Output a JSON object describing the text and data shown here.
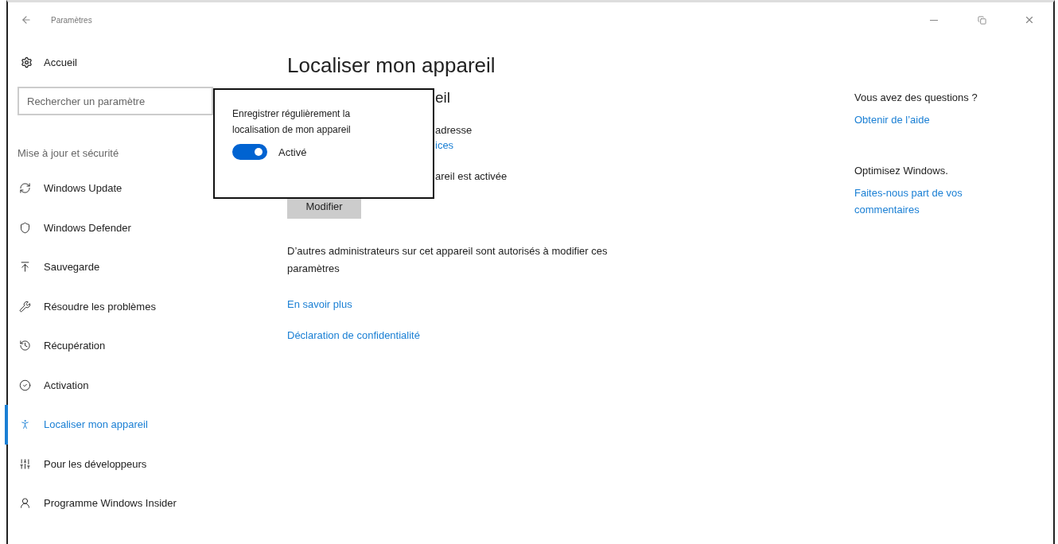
{
  "window": {
    "title": "Paramètres"
  },
  "sidebar": {
    "home": "Accueil",
    "search": {
      "placeholder": "Rechercher un paramètre"
    },
    "section": "Mise à jour et sécurité",
    "items": [
      {
        "label": "Windows Update",
        "selected": false
      },
      {
        "label": "Windows Defender",
        "selected": false
      },
      {
        "label": "Sauvegarde",
        "selected": false
      },
      {
        "label": "Résoudre les problèmes",
        "selected": false
      },
      {
        "label": "Récupération",
        "selected": false
      },
      {
        "label": "Activation",
        "selected": false
      },
      {
        "label": "Localiser mon appareil",
        "selected": true
      },
      {
        "label": "Pour les développeurs",
        "selected": false
      },
      {
        "label": "Programme Windows Insider",
        "selected": false
      }
    ]
  },
  "main": {
    "title": "Localiser mon appareil",
    "subheading": "eil",
    "line_1": "adresse",
    "link_1": "ices",
    "status": "areil est activée",
    "button": "Modifier",
    "note": "D’autres administrateurs sur cet appareil sont autorisés à modifier ces paramètres",
    "links": [
      "En savoir plus",
      "Déclaration de confidentialité"
    ]
  },
  "popup": {
    "text": "Enregistrer régulièrement la localisation de mon appareil",
    "toggle": {
      "on": true,
      "label": "Activé"
    }
  },
  "aside": [
    {
      "heading": "Vous avez des questions ?",
      "link": "Obtenir de l’aide"
    },
    {
      "heading": "Optimisez Windows.",
      "link": "Faites-nous part de vos commentaires"
    }
  ]
}
